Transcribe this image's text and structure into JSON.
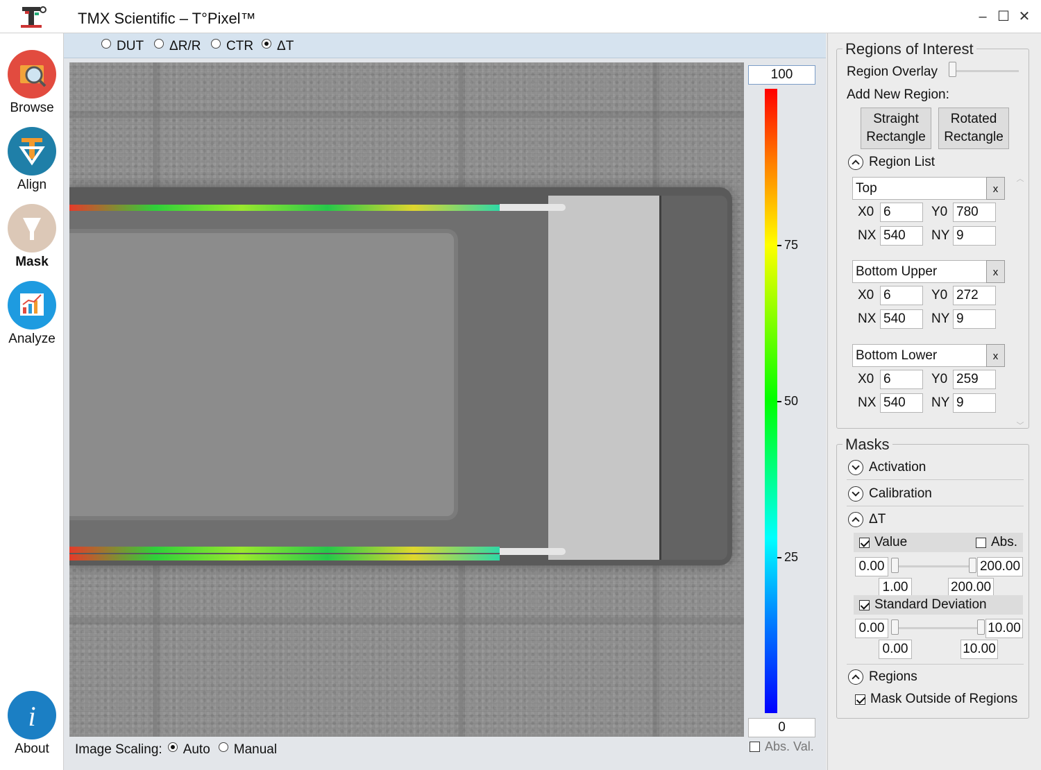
{
  "window": {
    "title": "TMX Scientific – T°Pixel™"
  },
  "nav": [
    {
      "label": "Browse",
      "icon": "browse-icon"
    },
    {
      "label": "Align",
      "icon": "align-icon"
    },
    {
      "label": "Mask",
      "icon": "mask-icon"
    },
    {
      "label": "Analyze",
      "icon": "analyze-icon"
    },
    {
      "label": "About",
      "icon": "info-icon"
    }
  ],
  "modes": [
    {
      "label": "DUT",
      "checked": false
    },
    {
      "label": "ΔR/R",
      "checked": false
    },
    {
      "label": "CTR",
      "checked": false
    },
    {
      "label": "ΔT",
      "checked": true
    }
  ],
  "colorscale": {
    "max": "100",
    "min": "0",
    "ticks": [
      "75",
      "50",
      "25"
    ],
    "abs_val_label": "Abs. Val.",
    "abs_val_checked": false
  },
  "image_scaling": {
    "label": "Image Scaling:",
    "options": [
      "Auto",
      "Manual"
    ],
    "selected": "Auto"
  },
  "roi": {
    "title": "Regions of Interest",
    "overlay_label": "Region Overlay",
    "overlay_value": 0,
    "add_label": "Add New Region:",
    "btn_straight_1": "Straight",
    "btn_straight_2": "Rectangle",
    "btn_rotated_1": "Rotated",
    "btn_rotated_2": "Rectangle",
    "list_label": "Region List",
    "delete_label": "x",
    "regions": [
      {
        "name": "Top",
        "x0": "6",
        "y0": "780",
        "nx": "540",
        "ny": "9"
      },
      {
        "name": "Bottom Upper",
        "x0": "6",
        "y0": "272",
        "nx": "540",
        "ny": "9"
      },
      {
        "name": "Bottom Lower",
        "x0": "6",
        "y0": "259",
        "nx": "540",
        "ny": "9"
      }
    ],
    "labels": {
      "x0": "X0",
      "y0": "Y0",
      "nx": "NX",
      "ny": "NY"
    }
  },
  "masks": {
    "title": "Masks",
    "activation": "Activation",
    "calibration": "Calibration",
    "dt": "ΔT",
    "value_label": "Value",
    "value_checked": true,
    "abs_label": "Abs.",
    "abs_checked": false,
    "value_min": "0.00",
    "value_max": "200.00",
    "value_low": "1.00",
    "value_high": "200.00",
    "std_label": "Standard Deviation",
    "std_checked": true,
    "std_min": "0.00",
    "std_max": "10.00",
    "std_low": "0.00",
    "std_high": "10.00",
    "regions_label": "Regions",
    "mask_outside_label": "Mask Outside of Regions",
    "mask_outside_checked": true
  }
}
